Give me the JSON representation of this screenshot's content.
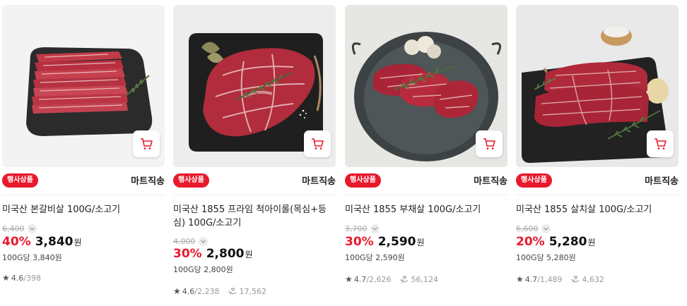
{
  "colors": {
    "accent": "#e8192c",
    "text": "#222222",
    "muted": "#999999"
  },
  "products": [
    {
      "event_badge": "행사상품",
      "delivery": "마트직송",
      "title": "미국산 본갈비살 100G/소고기",
      "original_price": "6,400",
      "discount": "40%",
      "price": "3,840",
      "won": "원",
      "unit_price": "100G당 3,840원",
      "rating": "4.6",
      "reviews": "398",
      "wish_count": ""
    },
    {
      "event_badge": "행사상품",
      "delivery": "마트직송",
      "title": "미국산 1855 프라임 척아이롤(목심+등심) 100G/소고기",
      "original_price": "4,000",
      "discount": "30%",
      "price": "2,800",
      "won": "원",
      "unit_price": "100G당 2,800원",
      "rating": "4.6",
      "reviews": "2,238",
      "wish_count": "17,562"
    },
    {
      "event_badge": "행사상품",
      "delivery": "마트직송",
      "title": "미국산 1855 부채살 100G/소고기",
      "original_price": "3,700",
      "discount": "30%",
      "price": "2,590",
      "won": "원",
      "unit_price": "100G당 2,590원",
      "rating": "4.7",
      "reviews": "2,626",
      "wish_count": "56,124"
    },
    {
      "event_badge": "행사상품",
      "delivery": "마트직송",
      "title": "미국산 1855 살치살 100G/소고기",
      "original_price": "6,600",
      "discount": "20%",
      "price": "5,280",
      "won": "원",
      "unit_price": "100G당 5,280원",
      "rating": "4.7",
      "reviews": "1,489",
      "wish_count": "4,632"
    }
  ],
  "icons": {
    "cart": "shopping-cart-icon",
    "star": "star-icon",
    "wish": "hand-heart-icon",
    "chevron": "chevron-down-icon"
  }
}
